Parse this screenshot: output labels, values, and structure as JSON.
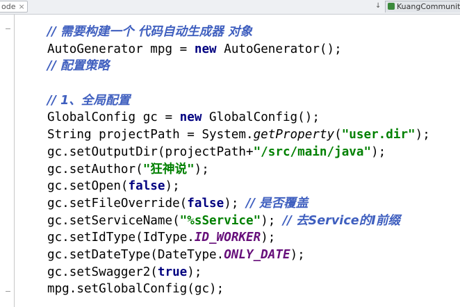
{
  "topbar": {
    "left_tab_label": "ode",
    "left_tab_close": "×",
    "nav_icon": "↓",
    "right_tab_label": "KuangCommunityAppli"
  },
  "code_lines": [
    {
      "parts": [
        {
          "t": "// 需要构建一个 代码自动生成器 对象",
          "c": "c"
        }
      ]
    },
    {
      "parts": [
        {
          "t": "AutoGenerator mpg = "
        },
        {
          "t": "new",
          "c": "k"
        },
        {
          "t": " AutoGenerator();"
        }
      ]
    },
    {
      "parts": [
        {
          "t": "// 配置策略",
          "c": "c"
        }
      ]
    },
    {
      "parts": []
    },
    {
      "parts": [
        {
          "t": "// 1、全局配置",
          "c": "c"
        }
      ]
    },
    {
      "parts": [
        {
          "t": "GlobalConfig gc = "
        },
        {
          "t": "new",
          "c": "k"
        },
        {
          "t": " GlobalConfig();"
        }
      ]
    },
    {
      "parts": [
        {
          "t": "String projectPath = System."
        },
        {
          "t": "getProperty",
          "c": "m"
        },
        {
          "t": "("
        },
        {
          "t": "\"user.dir\"",
          "c": "s"
        },
        {
          "t": ");"
        }
      ]
    },
    {
      "parts": [
        {
          "t": "gc.setOutputDir(projectPath+"
        },
        {
          "t": "\"/src/main/java\"",
          "c": "s"
        },
        {
          "t": ");"
        }
      ]
    },
    {
      "parts": [
        {
          "t": "gc.setAuthor("
        },
        {
          "t": "\"狂神说\"",
          "c": "s"
        },
        {
          "t": ");"
        }
      ]
    },
    {
      "parts": [
        {
          "t": "gc.setOpen("
        },
        {
          "t": "false",
          "c": "k"
        },
        {
          "t": ");"
        }
      ]
    },
    {
      "parts": [
        {
          "t": "gc.setFileOverride("
        },
        {
          "t": "false",
          "c": "k"
        },
        {
          "t": "); "
        },
        {
          "t": "// 是否覆盖",
          "c": "c"
        }
      ]
    },
    {
      "parts": [
        {
          "t": "gc.setServiceName("
        },
        {
          "t": "\"%sService\"",
          "c": "s"
        },
        {
          "t": "); "
        },
        {
          "t": "// 去Service的I前缀",
          "c": "c"
        }
      ]
    },
    {
      "parts": [
        {
          "t": "gc.setIdType(IdType."
        },
        {
          "t": "ID_WORKER",
          "c": "f"
        },
        {
          "t": ");"
        }
      ]
    },
    {
      "parts": [
        {
          "t": "gc.setDateType(DateType."
        },
        {
          "t": "ONLY_DATE",
          "c": "f"
        },
        {
          "t": ");"
        }
      ]
    },
    {
      "parts": [
        {
          "t": "gc.setSwagger2("
        },
        {
          "t": "true",
          "c": "k"
        },
        {
          "t": ");"
        }
      ]
    },
    {
      "parts": [
        {
          "t": "mpg.setGlobalConfig(gc);"
        }
      ]
    }
  ]
}
